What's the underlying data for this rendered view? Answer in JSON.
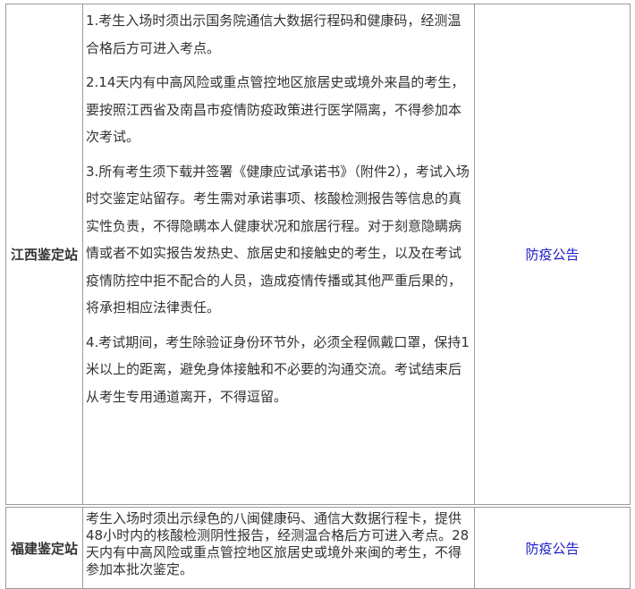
{
  "rows": [
    {
      "station": "江西鉴定站",
      "requirements": [
        "1.考生入场时须出示国务院通信大数据行程码和健康码，经测温合格后方可进入考点。",
        "2.14天内有中高风险或重点管控地区旅居史或境外来昌的考生，要按照江西省及南昌市疫情防疫政策进行医学隔离，不得参加本次考试。",
        "3.所有考生须下载并签署《健康应试承诺书》（附件2），考试入场时交鉴定站留存。考生需对承诺事项、核酸检测报告等信息的真实性负责，不得隐瞒本人健康状况和旅居行程。对于刻意隐瞒病情或者不如实报告发热史、旅居史和接触史的考生，以及在考试疫情防控中拒不配合的人员，造成疫情传播或其他严重后果的，将承担相应法律责任。",
        "4.考试期间，考生除验证身份环节外，必须全程佩戴口罩，保持1米以上的距离，避免身体接触和不必要的沟通交流。考试结束后从考生专用通道离开，不得逗留。"
      ],
      "notice_link": "防疫公告"
    },
    {
      "station": "福建鉴定站",
      "requirements": [
        "考生入场时须出示绿色的八闽健康码、通信大数据行程卡，提供48小时内的核酸检测阴性报告，经测温合格后方可进入考点。28天内有中高风险或重点管控地区旅居史或境外来闽的考生，不得参加本批次鉴定。"
      ],
      "notice_link": "防疫公告"
    }
  ],
  "colors": {
    "border": "#9a9a9a",
    "text": "#333333",
    "link": "#1a1acc"
  }
}
